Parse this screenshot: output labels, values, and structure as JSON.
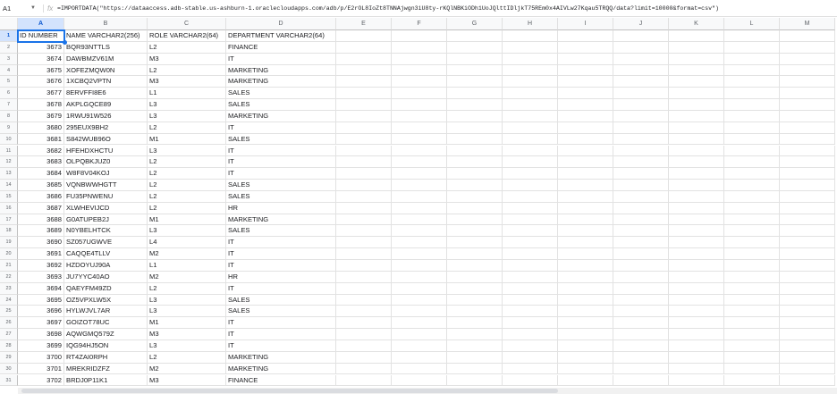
{
  "formula_bar": {
    "name_box": "A1",
    "fx_label": "fx",
    "formula": "=IMPORTDATA(\"https://dataaccess.adb-stable.us-ashburn-1.oraclecloudapps.com/adb/p/E2rOL8IoZt8TNNAjwgn3iU8ty-rKQlNBKiODh1UoJQlttIDljkT75REm0x4AIVLw27Kqau5TRQQ/data?limit=10000&format=csv\")"
  },
  "columns": [
    "A",
    "B",
    "C",
    "D",
    "E",
    "F",
    "G",
    "H",
    "I",
    "J",
    "K",
    "L",
    "M"
  ],
  "header_row": [
    "ID NUMBER",
    "NAME VARCHAR2(256)",
    "ROLE VARCHAR2(64)",
    "DEPARTMENT VARCHAR2(64)"
  ],
  "rows": [
    [
      "3673",
      "BQR93NTTLS",
      "L2",
      "FINANCE"
    ],
    [
      "3674",
      "DAWBMZV61M",
      "M3",
      "IT"
    ],
    [
      "3675",
      "XOFEZMQW0N",
      "L2",
      "MARKETING"
    ],
    [
      "3676",
      "1XCBQ2VPTN",
      "M3",
      "MARKETING"
    ],
    [
      "3677",
      "8ERVFFI8E6",
      "L1",
      "SALES"
    ],
    [
      "3678",
      "AKPLGQCE89",
      "L3",
      "SALES"
    ],
    [
      "3679",
      "1RWU91W526",
      "L3",
      "MARKETING"
    ],
    [
      "3680",
      "295EUX9BH2",
      "L2",
      "IT"
    ],
    [
      "3681",
      "S842WUB96O",
      "M1",
      "SALES"
    ],
    [
      "3682",
      "HFEHDXHCTU",
      "L3",
      "IT"
    ],
    [
      "3683",
      "OLPQBKJUZ0",
      "L2",
      "IT"
    ],
    [
      "3684",
      "W8F8V04KOJ",
      "L2",
      "IT"
    ],
    [
      "3685",
      "VQNBWWHGTT",
      "L2",
      "SALES"
    ],
    [
      "3686",
      "FU35PNWENU",
      "L2",
      "SALES"
    ],
    [
      "3687",
      "XLWHEVIJCD",
      "L2",
      "HR"
    ],
    [
      "3688",
      "G0ATUPEB2J",
      "M1",
      "MARKETING"
    ],
    [
      "3689",
      "N0YBELHTCK",
      "L3",
      "SALES"
    ],
    [
      "3690",
      "SZ057UGWVE",
      "L4",
      "IT"
    ],
    [
      "3691",
      "CAQQE4TLLV",
      "M2",
      "IT"
    ],
    [
      "3692",
      "HZDOYUJ90A",
      "L1",
      "IT"
    ],
    [
      "3693",
      "JU7YYC40AO",
      "M2",
      "HR"
    ],
    [
      "3694",
      "QAEYFM49ZD",
      "L2",
      "IT"
    ],
    [
      "3695",
      "OZ5VPXLW5X",
      "L3",
      "SALES"
    ],
    [
      "3696",
      "HYLWJVL7AR",
      "L3",
      "SALES"
    ],
    [
      "3697",
      "GOIZOT78UC",
      "M1",
      "IT"
    ],
    [
      "3698",
      "AQWGMQ579Z",
      "M3",
      "IT"
    ],
    [
      "3699",
      "IQG94HJ5ON",
      "L3",
      "IT"
    ],
    [
      "3700",
      "RT4ZAI0RPH",
      "L2",
      "MARKETING"
    ],
    [
      "3701",
      "MREKRIDZFZ",
      "M2",
      "MARKETING"
    ],
    [
      "3702",
      "BRDJ0P11K1",
      "M3",
      "FINANCE"
    ]
  ],
  "colors": {
    "selection": "#1a73e8",
    "header_bg": "#f8f9fa",
    "selected_header_bg": "#d3e3fd"
  }
}
